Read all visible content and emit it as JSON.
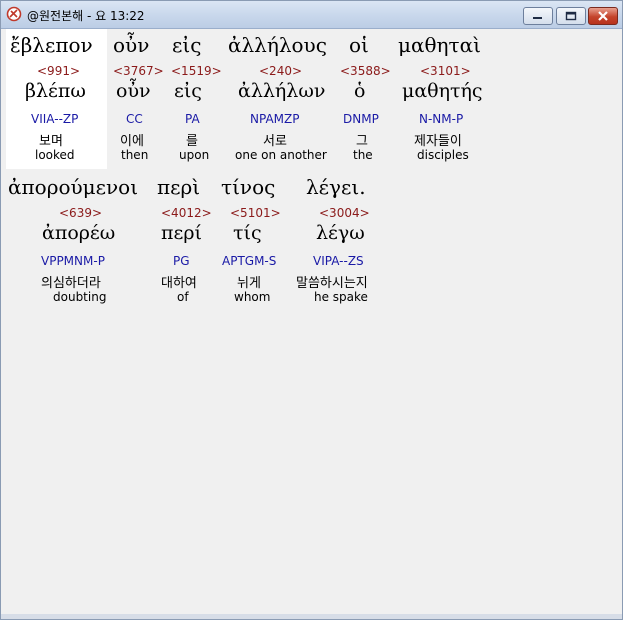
{
  "window": {
    "title": "@원전본해 - 요 13:22"
  },
  "words": [
    {
      "greek": "ἔβλεπον",
      "strong": "<991>",
      "lemma": "βλέπω",
      "parse": "VIIA--ZP",
      "korean": "보며",
      "english": "looked"
    },
    {
      "greek": "οὖν",
      "strong": "<3767>",
      "lemma": "οὖν",
      "parse": "CC",
      "korean": "이에",
      "english": "then"
    },
    {
      "greek": "εἰς",
      "strong": "<1519>",
      "lemma": "εἰς",
      "parse": "PA",
      "korean": "를",
      "english": "upon"
    },
    {
      "greek": "ἀλλήλους",
      "strong": "<240>",
      "lemma": "ἀλλήλων",
      "parse": "NPAMZP",
      "korean": "서로",
      "english": "one on another"
    },
    {
      "greek": "οἱ",
      "strong": "<3588>",
      "lemma": "ὁ",
      "parse": "DNMP",
      "korean": "그",
      "english": "the"
    },
    {
      "greek": "μαθηταὶ",
      "strong": "<3101>",
      "lemma": "μαθητής",
      "parse": "N-NM-P",
      "korean": "제자들이",
      "english": "disciples"
    },
    {
      "greek": "ἀπορούμενοι",
      "strong": "<639>",
      "lemma": "ἀπορέω",
      "parse": "VPPMNM-P",
      "korean": "의심하더라",
      "english": "doubting"
    },
    {
      "greek": "περὶ",
      "strong": "<4012>",
      "lemma": "περί",
      "parse": "PG",
      "korean": "대하여",
      "english": "of"
    },
    {
      "greek": "τίνος",
      "strong": "<5101>",
      "lemma": "τίς",
      "parse": "APTGM-S",
      "korean": "뉘게",
      "english": "whom"
    },
    {
      "greek": "λέγει.",
      "strong": "<3004>",
      "lemma": "λέγω",
      "parse": "VIPA--ZS",
      "korean": "말씀하시는지",
      "english": "he spake"
    }
  ]
}
